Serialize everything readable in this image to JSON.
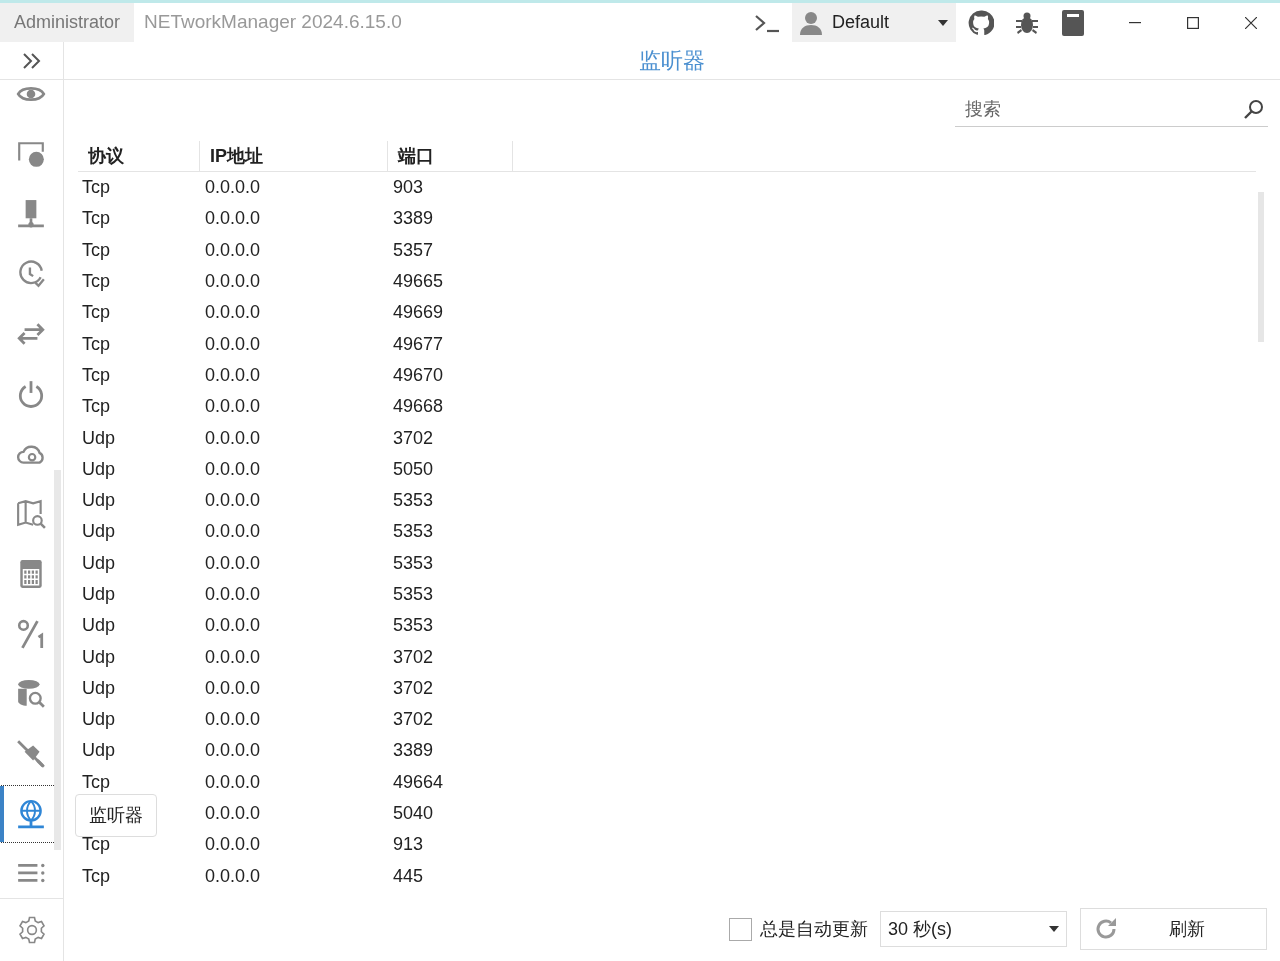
{
  "window": {
    "user": "Administrator",
    "title": "NETworkManager 2024.6.15.0",
    "profile": "Default"
  },
  "header": "监听器",
  "sidebar": {
    "items": [
      {
        "kind": "eye",
        "selected": false
      },
      {
        "kind": "globe-screen",
        "selected": false
      },
      {
        "kind": "server",
        "selected": false
      },
      {
        "kind": "clock",
        "selected": false
      },
      {
        "kind": "arrows",
        "selected": false
      },
      {
        "kind": "power",
        "selected": false
      },
      {
        "kind": "cloud",
        "selected": false
      },
      {
        "kind": "map",
        "selected": false
      },
      {
        "kind": "calculator",
        "selected": false
      },
      {
        "kind": "fraction",
        "selected": false
      },
      {
        "kind": "database",
        "selected": false
      },
      {
        "kind": "plug",
        "selected": false
      },
      {
        "kind": "network",
        "selected": true
      },
      {
        "kind": "list",
        "selected": false
      }
    ]
  },
  "tooltip": "监听器",
  "search": {
    "placeholder": "搜索"
  },
  "table": {
    "columns": [
      "协议",
      "IP地址",
      "端口"
    ],
    "rows": [
      {
        "protocol": "Tcp",
        "ip": "0.0.0.0",
        "port": "903"
      },
      {
        "protocol": "Tcp",
        "ip": "0.0.0.0",
        "port": "3389"
      },
      {
        "protocol": "Tcp",
        "ip": "0.0.0.0",
        "port": "5357"
      },
      {
        "protocol": "Tcp",
        "ip": "0.0.0.0",
        "port": "49665"
      },
      {
        "protocol": "Tcp",
        "ip": "0.0.0.0",
        "port": "49669"
      },
      {
        "protocol": "Tcp",
        "ip": "0.0.0.0",
        "port": "49677"
      },
      {
        "protocol": "Tcp",
        "ip": "0.0.0.0",
        "port": "49670"
      },
      {
        "protocol": "Tcp",
        "ip": "0.0.0.0",
        "port": "49668"
      },
      {
        "protocol": "Udp",
        "ip": "0.0.0.0",
        "port": "3702"
      },
      {
        "protocol": "Udp",
        "ip": "0.0.0.0",
        "port": "5050"
      },
      {
        "protocol": "Udp",
        "ip": "0.0.0.0",
        "port": "5353"
      },
      {
        "protocol": "Udp",
        "ip": "0.0.0.0",
        "port": "5353"
      },
      {
        "protocol": "Udp",
        "ip": "0.0.0.0",
        "port": "5353"
      },
      {
        "protocol": "Udp",
        "ip": "0.0.0.0",
        "port": "5353"
      },
      {
        "protocol": "Udp",
        "ip": "0.0.0.0",
        "port": "5353"
      },
      {
        "protocol": "Udp",
        "ip": "0.0.0.0",
        "port": "3702"
      },
      {
        "protocol": "Udp",
        "ip": "0.0.0.0",
        "port": "3702"
      },
      {
        "protocol": "Udp",
        "ip": "0.0.0.0",
        "port": "3702"
      },
      {
        "protocol": "Udp",
        "ip": "0.0.0.0",
        "port": "3389"
      },
      {
        "protocol": "Tcp",
        "ip": "0.0.0.0",
        "port": "49664"
      },
      {
        "ip": "0.0.0.0",
        "port": "5040"
      },
      {
        "protocol": "Tcp",
        "ip": "0.0.0.0",
        "port": "913"
      },
      {
        "protocol": "Tcp",
        "ip": "0.0.0.0",
        "port": "445"
      }
    ]
  },
  "footer": {
    "auto_refresh": {
      "label": "总是自动更新",
      "checked": false
    },
    "interval": "30 秒(s)",
    "refresh": "刷新"
  }
}
